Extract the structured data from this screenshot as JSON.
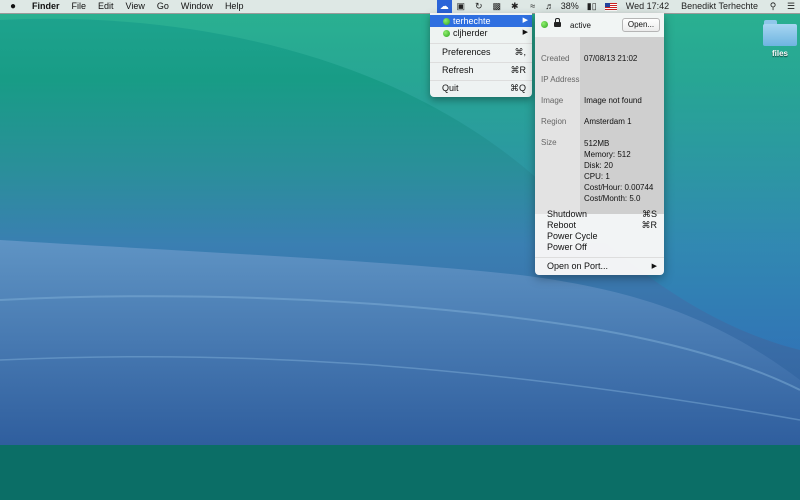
{
  "menubar": {
    "apple": "",
    "app": "Finder",
    "menus": [
      "File",
      "Edit",
      "View",
      "Go",
      "Window",
      "Help"
    ],
    "battery": "38%",
    "clock": "Wed 17:42",
    "user": "Benedikt Terhechte"
  },
  "desktop": {
    "file_label": "files"
  },
  "droplets_menu": {
    "servers": [
      {
        "name": "terhechte",
        "status_color": "#3cb52d",
        "selected": true
      },
      {
        "name": "cljherder",
        "status_color": "#3cb52d",
        "selected": false
      }
    ],
    "preferences": {
      "label": "Preferences",
      "shortcut": "⌘,"
    },
    "refresh": {
      "label": "Refresh",
      "shortcut": "⌘R"
    },
    "quit": {
      "label": "Quit",
      "shortcut": "⌘Q"
    }
  },
  "server_detail": {
    "status": "active",
    "open_button": "Open...",
    "created_label": "Created",
    "created_value": "07/08/13 21:02",
    "ip_label": "IP Address",
    "ip_value": "",
    "image_label": "Image",
    "image_value": "Image not found",
    "region_label": "Region",
    "region_value": "Amsterdam 1",
    "size_label": "Size",
    "size_lines": [
      "512MB",
      "Memory: 512",
      "Disk: 20",
      "CPU: 1",
      "Cost/Hour: 0.00744",
      "Cost/Month: 5.0"
    ],
    "actions": {
      "shutdown": {
        "label": "Shutdown",
        "shortcut": "⌘S"
      },
      "reboot": {
        "label": "Reboot",
        "shortcut": "⌘R"
      },
      "power_cycle": {
        "label": "Power Cycle"
      },
      "power_off": {
        "label": "Power Off"
      },
      "open_on_port": {
        "label": "Open on Port..."
      }
    }
  },
  "colors": {
    "selection": "#2f6fe0",
    "wallpaper_top": "#1fa58f",
    "wallpaper_bottom": "#2f5f9c",
    "band": "#0b6e66"
  }
}
